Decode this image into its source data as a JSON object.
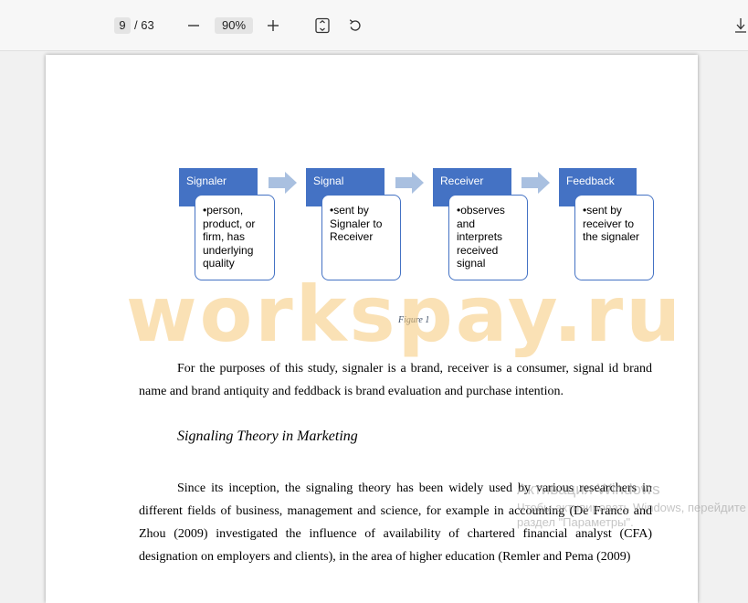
{
  "toolbar": {
    "current_page": "9",
    "page_total": "/ 63",
    "zoom": "90%",
    "icons": {
      "zoom_out": "minus-icon",
      "zoom_in": "plus-icon",
      "fit": "fit-page-icon",
      "rotate": "rotate-icon",
      "download": "download-icon"
    }
  },
  "diagram": {
    "steps": [
      {
        "title": "Signaler",
        "body": "•person, product, or firm, has underlying quality"
      },
      {
        "title": "Signal",
        "body": "•sent by Signaler to Receiver"
      },
      {
        "title": "Receiver",
        "body": "•observes and interprets received signal"
      },
      {
        "title": "Feedback",
        "body": "•sent by receiver to the signaler"
      }
    ],
    "caption": "Figure 1",
    "colors": {
      "header": "#4472c4",
      "arrow": "#a9c0e0"
    }
  },
  "document": {
    "paragraph_1": "For the purposes of this study, signaler is a brand, receiver is a consumer, signal id brand name and brand antiquity and feddback is brand evaluation and purchase intention.",
    "subheading": "Signaling Theory in Marketing",
    "paragraph_2": "Since its inception, the signaling theory has been widely used by various researchers in different fields of business, management and science, for example in accounting (De Franco and Zhou (2009) investigated the influence of availability of chartered financial analyst (CFA) designation on employers and clients), in the area of higher education (Remler and Pema (2009)"
  },
  "overlays": {
    "watermark": "workspay.ru",
    "activation_title": "Активация Windows",
    "activation_line1": "Чтобы активировать Windows, перейдите в",
    "activation_line2": "раздел \"Параметры\"."
  }
}
